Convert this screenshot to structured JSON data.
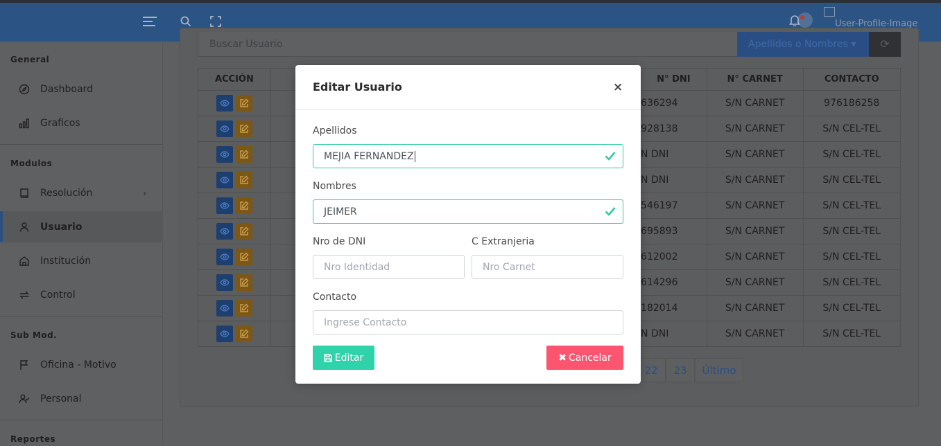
{
  "header": {
    "profile_alt": "User-Profile-Image"
  },
  "sidebar": {
    "sections": [
      {
        "title": "General",
        "items": [
          {
            "label": "Dashboard",
            "icon": "compass-icon"
          },
          {
            "label": "Graficos",
            "icon": "bar-chart-icon"
          }
        ]
      },
      {
        "title": "Modulos",
        "items": [
          {
            "label": "Resolución",
            "icon": "book-icon"
          },
          {
            "label": "Usuario",
            "icon": "user-icon"
          },
          {
            "label": "Institución",
            "icon": "home-icon"
          },
          {
            "label": "Control",
            "icon": "repeat-icon"
          }
        ]
      },
      {
        "title": "Sub Mod.",
        "items": [
          {
            "label": "Oficina - Motivo",
            "icon": "flag-icon"
          },
          {
            "label": "Personal",
            "icon": "user-check-icon"
          }
        ]
      },
      {
        "title": "Reportes",
        "items": []
      }
    ],
    "active": "Usuario"
  },
  "search": {
    "placeholder": "Buscar Usuario",
    "filter_label": "Apellidos o Nombres"
  },
  "table": {
    "headers": [
      "ACCIÓN",
      "",
      "",
      "",
      "",
      "N° DNI",
      "N° CARNET",
      "CONTACTO"
    ],
    "visible_dni": [
      "636294",
      "928138",
      "N DNI",
      "N DNI",
      "546197",
      "695893",
      "612002",
      "614296",
      "182014",
      "N DNI"
    ],
    "carnet": [
      "S/N CARNET",
      "S/N CARNET",
      "S/N CARNET",
      "S/N CARNET",
      "S/N CARNET",
      "S/N CARNET",
      "S/N CARNET",
      "S/N CARNET",
      "S/N CARNET",
      "S/N CARNET"
    ],
    "contacto": [
      "976186258",
      "S/N CEL-TEL",
      "S/N CEL-TEL",
      "S/N CEL-TEL",
      "S/N CEL-TEL",
      "S/N CEL-TEL",
      "S/N CEL-TEL",
      "S/N CEL-TEL",
      "S/N CEL-TEL",
      "S/N CEL-TEL"
    ]
  },
  "pagination": {
    "pages": [
      "22",
      "23"
    ],
    "last": "Último"
  },
  "modal": {
    "title": "Editar Usuario",
    "close": "×",
    "fields": {
      "apellidos": {
        "label": "Apellidos",
        "value": "MEJIA FERNANDEZ"
      },
      "nombres": {
        "label": "Nombres",
        "value": "JEIMER"
      },
      "dni": {
        "label": "Nro de DNI",
        "placeholder": "Nro Identidad"
      },
      "extranjeria": {
        "label": "C Extranjeria",
        "placeholder": "Nro Carnet"
      },
      "contacto": {
        "label": "Contacto",
        "placeholder": "Ingrese Contacto"
      }
    },
    "edit_label": "Editar",
    "cancel_label": "Cancelar"
  },
  "colors": {
    "header_bg": "#2b5384",
    "success": "#2fd2a9",
    "danger": "#fb5570",
    "valid_border": "#2ecc9d"
  }
}
